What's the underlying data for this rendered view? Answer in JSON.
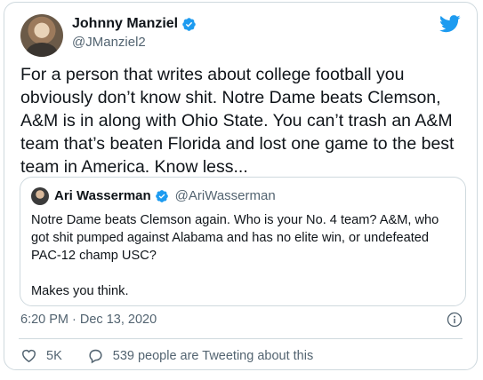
{
  "author": {
    "name": "Johnny Manziel",
    "handle": "@JManziel2"
  },
  "tweet": {
    "text": "For a person that writes about college football you obviously don’t know shit. Notre Dame beats Clemson, A&M is in along with Ohio State. You can’t trash an A&M team that’s beaten Florida and lost one game to the best team in America. Know less..."
  },
  "quoted": {
    "name": "Ari Wasserman",
    "handle": "@AriWasserman",
    "text": "Notre Dame beats Clemson again. Who is your No. 4 team? A&M, who got shit pumped against Alabama and has no elite win, or undefeated PAC-12 champ USC?\n\nMakes you think."
  },
  "meta": {
    "timestamp": "6:20 PM · Dec 13, 2020"
  },
  "actions": {
    "likes": "5K",
    "replies_label": "539 people are Tweeting about this"
  },
  "colors": {
    "verified": "#1d9bf0",
    "twitter_bird": "#1d9bf0",
    "like_icon": "#536471"
  }
}
